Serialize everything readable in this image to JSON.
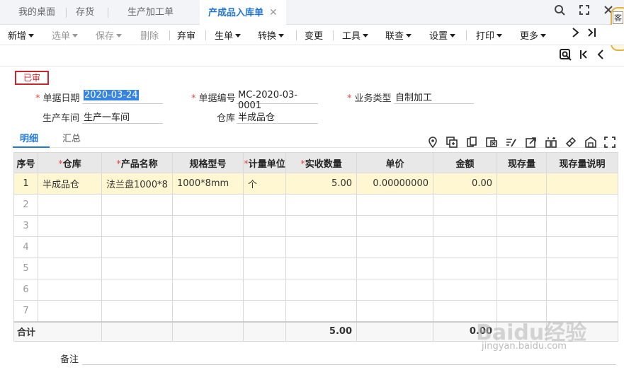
{
  "tabs": [
    {
      "label": "我的桌面"
    },
    {
      "label": "存货"
    },
    {
      "label": "生产加工单"
    },
    {
      "label": "产成品入库单",
      "active": true
    }
  ],
  "toolbar": {
    "new": "新增",
    "select_doc": "选单",
    "save": "保存",
    "delete": "删除",
    "abandon_review": "弃审",
    "generate": "生单",
    "convert": "转换",
    "change": "变更",
    "tools": "工具",
    "linked_query": "联查",
    "settings": "设置",
    "print": "打印",
    "more": "更多"
  },
  "side_tag": "客",
  "status_badge": "已审",
  "form": {
    "doc_date_label": "单据日期",
    "doc_date_value": "2020-03-24",
    "doc_no_label": "单据编号",
    "doc_no_value": "MC-2020-03-0001",
    "biz_type_label": "业务类型",
    "biz_type_value": "自制加工",
    "workshop_label": "生产车间",
    "workshop_value": "生产一车间",
    "warehouse_label": "仓库",
    "warehouse_value": "半成品仓"
  },
  "detail_tabs": {
    "detail": "明细",
    "summary": "汇总"
  },
  "grid": {
    "headers": {
      "seq": "序号",
      "warehouse": "仓库",
      "product": "产品名称",
      "spec": "规格型号",
      "unit": "计量单位",
      "qty": "实收数量",
      "price": "单价",
      "amount": "金额",
      "stock": "现存量",
      "stock_note": "现存量说明"
    },
    "rows": [
      {
        "seq": "1",
        "warehouse": "半成品仓",
        "product": "法兰盘1000*8",
        "spec": "1000*8mm",
        "unit": "个",
        "qty": "5.00",
        "price": "0.00000000",
        "amount": "0.00",
        "stock": "",
        "stock_note": ""
      },
      {
        "seq": "2"
      },
      {
        "seq": "3"
      },
      {
        "seq": "4"
      },
      {
        "seq": "5"
      },
      {
        "seq": "6"
      },
      {
        "seq": "7"
      }
    ],
    "total_label": "合计",
    "total_qty": "5.00",
    "total_amount": "0.00"
  },
  "remark_label": "备注",
  "watermark": "Baidu经验",
  "watermark_sub": "jingyan.baidu.com"
}
